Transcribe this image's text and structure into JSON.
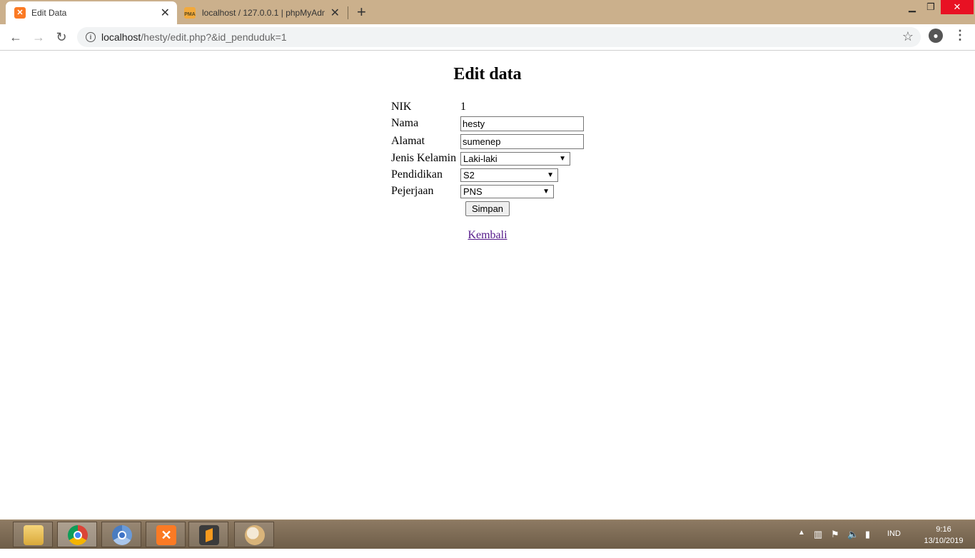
{
  "browser": {
    "tabs": [
      {
        "title": "Edit Data",
        "favicon": "xampp-icon",
        "active": true
      },
      {
        "title": "localhost / 127.0.0.1 | phpMyAdmin",
        "favicon": "phpmyadmin-icon",
        "active": false
      }
    ],
    "url_host": "localhost",
    "url_rest": "/hesty/edit.php?&id_penduduk=1"
  },
  "page": {
    "title": "Edit data",
    "fields": {
      "nik_label": "NIK",
      "nik_value": "1",
      "nama_label": "Nama",
      "nama_value": "hesty",
      "alamat_label": "Alamat",
      "alamat_value": "sumenep",
      "jk_label": "Jenis Kelamin",
      "jk_value": "Laki-laki",
      "pendidikan_label": "Pendidikan",
      "pendidikan_value": "S2",
      "pekerjaan_label": "Pejerjaan",
      "pekerjaan_value": "PNS"
    },
    "submit_label": "Simpan",
    "back_link": "Kembali"
  },
  "taskbar": {
    "apps": [
      "file-explorer-icon",
      "chrome-icon",
      "chromium-icon",
      "xampp-icon",
      "sublime-text-icon",
      "paint-icon"
    ],
    "language": "IND",
    "time": "9:16",
    "date": "13/10/2019"
  }
}
